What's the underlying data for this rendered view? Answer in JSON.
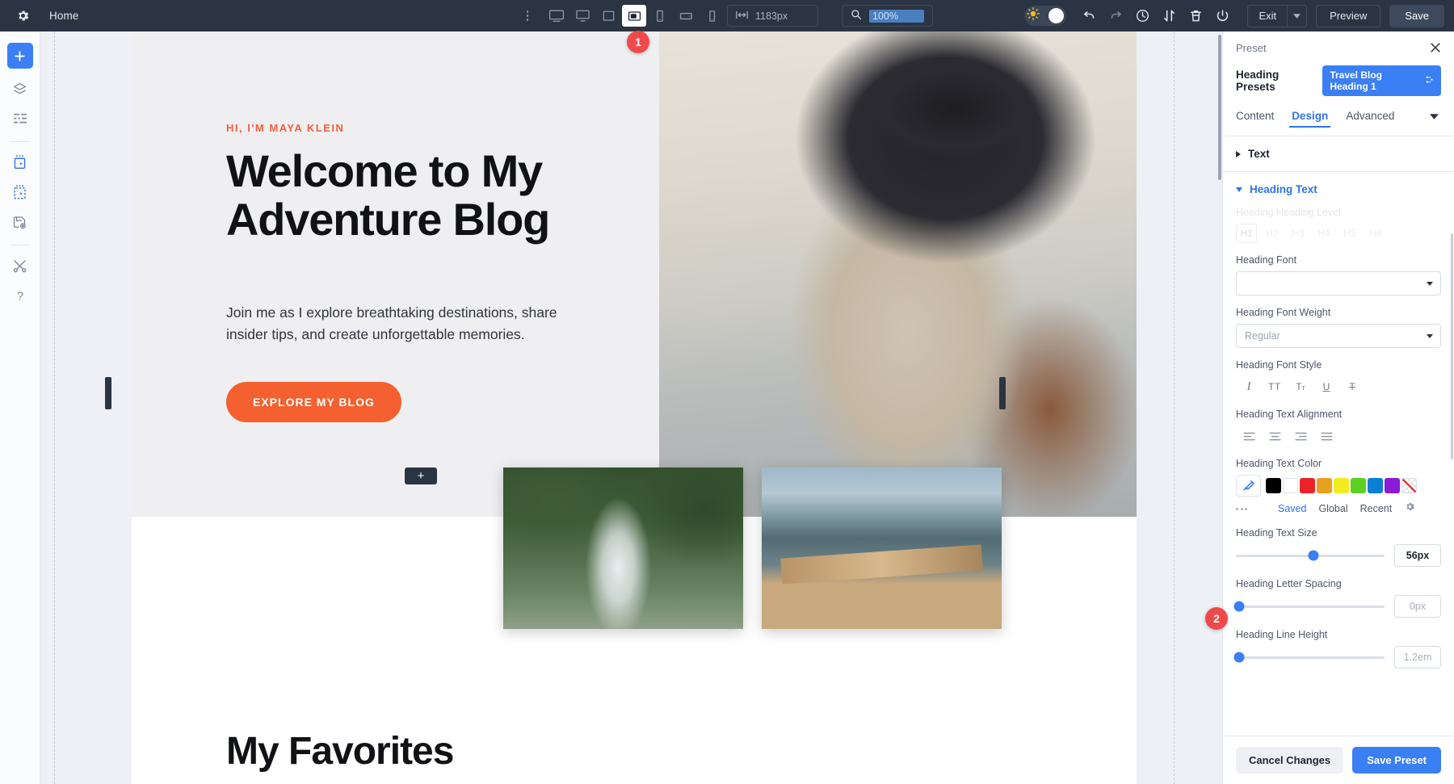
{
  "topbar": {
    "gear_icon": "gear-icon",
    "home_label": "Home",
    "kebab_icon": "vertical-dots-icon",
    "devices": [
      {
        "name": "desktop-large",
        "icon": "monitor-icon",
        "active": false
      },
      {
        "name": "desktop",
        "icon": "monitor-icon",
        "active": false
      },
      {
        "name": "laptop",
        "icon": "laptop-icon",
        "active": false
      },
      {
        "name": "tablet-landscape",
        "icon": "tablet-landscape-icon",
        "active": true
      },
      {
        "name": "tablet-portrait",
        "icon": "tablet-portrait-icon",
        "active": false
      },
      {
        "name": "mobile-landscape",
        "icon": "mobile-landscape-icon",
        "active": false
      },
      {
        "name": "mobile-portrait",
        "icon": "mobile-portrait-icon",
        "active": false
      }
    ],
    "width_icon": "arrows-horizontal-icon",
    "width_value": "1183px",
    "zoom_icon": "magnifier-icon",
    "zoom_value": "100%",
    "theme_toggle_icon": "sun-icon",
    "undo_icon": "undo-arrow-icon",
    "redo_icon": "redo-arrow-icon",
    "history_icon": "clock-history-icon",
    "sort_icon": "sort-updown-icon",
    "trash_icon": "trash-icon",
    "power_icon": "power-icon",
    "exit_label": "Exit",
    "exit_caret_icon": "chevron-down-icon",
    "preview_label": "Preview",
    "save_label": "Save"
  },
  "rail": {
    "items": [
      {
        "name": "add-element-button",
        "icon": "plus-icon"
      },
      {
        "name": "layers-button",
        "icon": "layers-icon"
      },
      {
        "name": "structure-button",
        "icon": "list-structure-icon"
      },
      {
        "name": "select-element-button",
        "icon": "select-element-icon"
      },
      {
        "name": "select-container-button",
        "icon": "select-container-icon"
      },
      {
        "name": "save-block-button",
        "icon": "save-block-icon"
      },
      {
        "name": "tools-button",
        "icon": "tools-icon"
      },
      {
        "name": "help-button",
        "icon": "question-mark-icon"
      }
    ]
  },
  "canvas": {
    "badge_one": "1",
    "badge_two": "2",
    "add_block_label": "+",
    "hero": {
      "eyebrow": "HI, I'M MAYA KLEIN",
      "heading": "Welcome to My Adventure Blog",
      "subtext": "Join me as I explore breathtaking destinations, share insider tips, and create unforgettable memories.",
      "cta_label": "EXPLORE MY BLOG",
      "accent_color": "#f4602f"
    },
    "favorites_heading": "My Favorites",
    "photos": [
      {
        "name": "waterfall-jungle-photo"
      },
      {
        "name": "lake-dock-photo"
      }
    ]
  },
  "panel": {
    "kicker": "Preset",
    "close_icon": "close-icon",
    "presets_label": "Heading Presets",
    "preset_chip": "Travel Blog Heading 1",
    "preset_chip_icon": "preset-swap-icon",
    "tabs": [
      {
        "label": "Content",
        "active": false
      },
      {
        "label": "Design",
        "active": true
      },
      {
        "label": "Advanced",
        "active": false
      }
    ],
    "tab_caret_icon": "chevron-down-icon",
    "tab_view_icon": "panel-layout-icon",
    "sections": [
      {
        "name": "text-section",
        "label": "Text",
        "expanded": false
      },
      {
        "name": "heading-text-section",
        "label": "Heading Text",
        "expanded": true
      }
    ],
    "heading_level": {
      "label": "Heading Heading Level",
      "options": [
        "H1",
        "H2",
        "H3",
        "H4",
        "H5",
        "H6"
      ],
      "selected": "H1",
      "disabled": true
    },
    "heading_font": {
      "label": "Heading Font",
      "value": "",
      "caret_icon": "caret-down-icon"
    },
    "heading_font_weight": {
      "label": "Heading Font Weight",
      "value": "Regular",
      "caret_icon": "caret-down-icon"
    },
    "heading_font_style": {
      "label": "Heading Font Style",
      "options": [
        {
          "name": "italic-icon",
          "glyph": "I"
        },
        {
          "name": "uppercase-icon",
          "glyph": "TT"
        },
        {
          "name": "capitalize-icon",
          "glyph": "Tт"
        },
        {
          "name": "underline-icon",
          "glyph": "U"
        },
        {
          "name": "strikethrough-icon",
          "glyph": "T"
        }
      ]
    },
    "heading_text_alignment": {
      "label": "Heading Text Alignment",
      "options": [
        "align-left-icon",
        "align-center-icon",
        "align-right-icon",
        "align-justify-icon"
      ]
    },
    "heading_text_color": {
      "label": "Heading Text Color",
      "eyedropper_icon": "eyedropper-icon",
      "swatches": [
        "#000000",
        "#ffffff",
        "#ec2227",
        "#e8a020",
        "#f2ec1f",
        "#5dd024",
        "#0a7fd4",
        "#8a1bd6",
        "transparent"
      ],
      "more_icon": "more-dots-icon",
      "links": [
        "Saved",
        "Global",
        "Recent"
      ],
      "settings_icon": "gear-icon"
    },
    "heading_text_size": {
      "label": "Heading Text Size",
      "value": "56px",
      "slider_pct": 52
    },
    "heading_letter_spacing": {
      "label": "Heading Letter Spacing",
      "value": "0px",
      "slider_pct": 2
    },
    "heading_line_height": {
      "label": "Heading Line Height",
      "value": "1.2em",
      "slider_pct": 2
    },
    "cancel_label": "Cancel Changes",
    "save_preset_label": "Save Preset"
  }
}
